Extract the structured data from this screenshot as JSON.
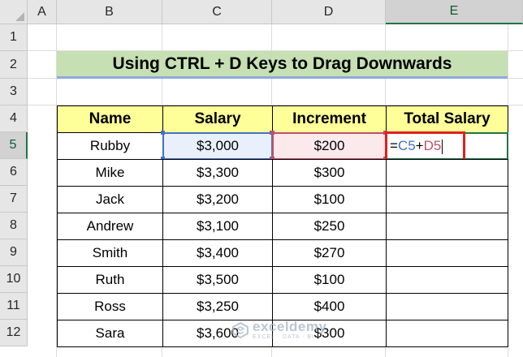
{
  "columns": [
    "A",
    "B",
    "C",
    "D",
    "E"
  ],
  "rows": [
    "1",
    "2",
    "3",
    "4",
    "5",
    "6",
    "7",
    "8",
    "9",
    "10",
    "11",
    "12"
  ],
  "selected_column": "E",
  "selected_row": "5",
  "title": "Using CTRL + D Keys to Drag Downwards",
  "table": {
    "headers": [
      "Name",
      "Salary",
      "Increment",
      "Total Salary"
    ],
    "rows": [
      {
        "name": "Rubby",
        "salary": "$3,000",
        "increment": "$200"
      },
      {
        "name": "Mike",
        "salary": "$3,300",
        "increment": "$300"
      },
      {
        "name": "Jack",
        "salary": "$3,200",
        "increment": "$100"
      },
      {
        "name": "Andrew",
        "salary": "$3,100",
        "increment": "$250"
      },
      {
        "name": "Smith",
        "salary": "$3,400",
        "increment": "$270"
      },
      {
        "name": "Ruth",
        "salary": "$3,500",
        "increment": "$100"
      },
      {
        "name": "Ross",
        "salary": "$3,250",
        "increment": "$400"
      },
      {
        "name": "Sara",
        "salary": "$3,600",
        "increment": "$300"
      }
    ]
  },
  "formula": {
    "eq": "=",
    "ref1": "C5",
    "op": "+",
    "ref2": "D5"
  },
  "watermark": {
    "name": "exceldemy",
    "tagline": "EXCEL · DATA · BI"
  },
  "colors": {
    "header_fill": "#ffff99",
    "title_fill": "#c6e0b4",
    "ref1_color": "#4472c4",
    "ref2_color": "#c0506a",
    "highlight_box": "#e0201b",
    "active_border": "#217346"
  }
}
